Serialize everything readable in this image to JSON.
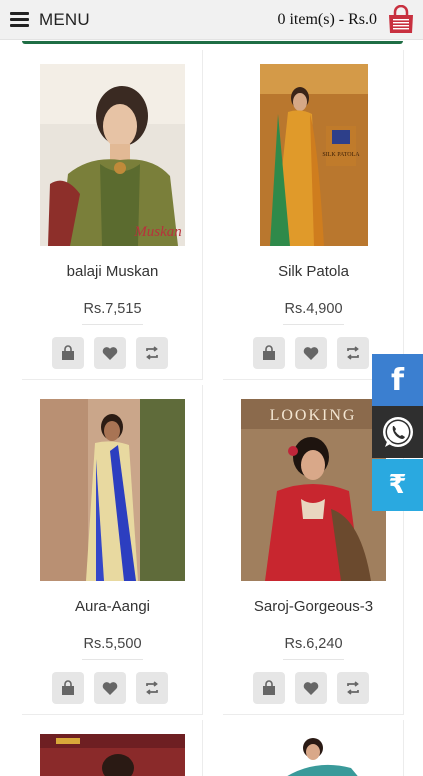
{
  "header": {
    "menu_label": "MENU",
    "cart_text": "0 item(s) - Rs.0",
    "accent": "#c8303f"
  },
  "products": [
    {
      "name": "balaji Muskan",
      "price": "Rs.7,515",
      "brand_text": "Muskan"
    },
    {
      "name": "Silk Patola",
      "price": "Rs.4,900"
    },
    {
      "name": "Aura-Aangi",
      "price": "Rs.5,500"
    },
    {
      "name": "Saroj-Gorgeous-3",
      "price": "Rs.6,240",
      "brand_text": "LOOKING"
    }
  ],
  "side_buttons": {
    "facebook_icon": "facebook-icon",
    "whatsapp_icon": "whatsapp-icon",
    "rupee_label": "₹"
  }
}
